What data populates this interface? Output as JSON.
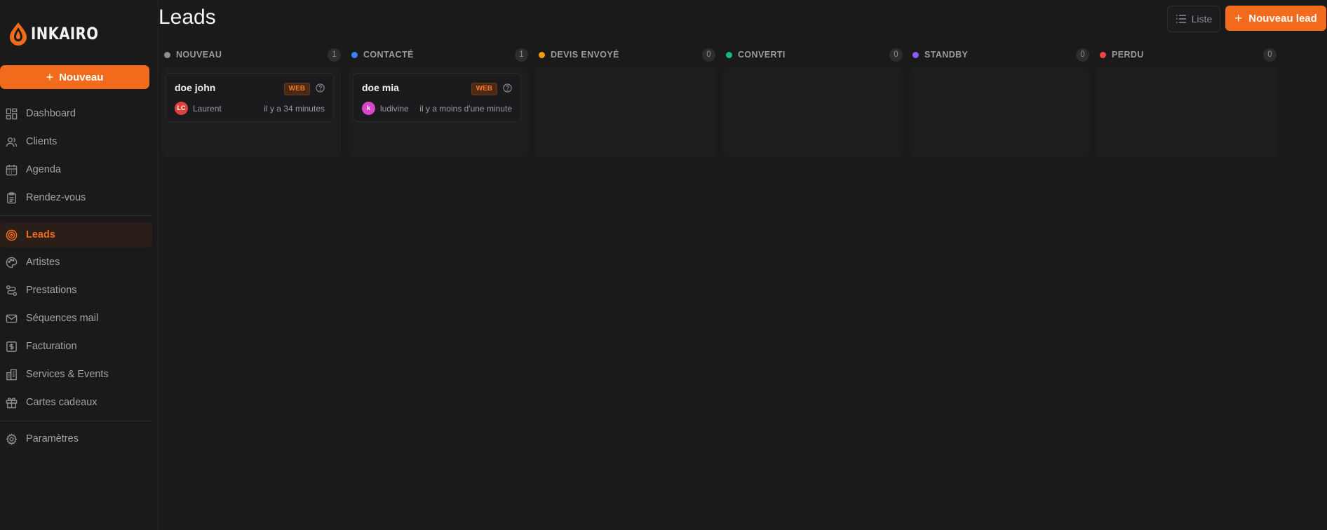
{
  "app": {
    "logo_text": "INKAIRO"
  },
  "sidebar": {
    "new_label": "Nouveau",
    "items": [
      {
        "label": "Dashboard",
        "icon": "dashboard-icon"
      },
      {
        "label": "Clients",
        "icon": "users-icon"
      },
      {
        "label": "Agenda",
        "icon": "calendar-icon"
      },
      {
        "label": "Rendez-vous",
        "icon": "clipboard-icon"
      },
      {
        "label": "Leads",
        "icon": "target-icon",
        "active": true
      },
      {
        "label": "Artistes",
        "icon": "palette-icon"
      },
      {
        "label": "Prestations",
        "icon": "route-icon"
      },
      {
        "label": "Séquences mail",
        "icon": "mail-icon"
      },
      {
        "label": "Facturation",
        "icon": "invoice-icon"
      },
      {
        "label": "Services & Events",
        "icon": "building-icon"
      },
      {
        "label": "Cartes cadeaux",
        "icon": "gift-icon"
      },
      {
        "label": "Paramètres",
        "icon": "gear-icon"
      }
    ]
  },
  "header": {
    "title": "Leads",
    "list_label": "Liste",
    "new_lead_label": "Nouveau lead"
  },
  "colors": {
    "accent": "#f26b1d",
    "nouveau": "#8e8e93",
    "contacte": "#3b82f6",
    "devis": "#f59e0b",
    "converti": "#10b981",
    "standby": "#8b5cf6",
    "perdu": "#ef4444"
  },
  "columns": [
    {
      "name": "NOUVEAU",
      "count": "1"
    },
    {
      "name": "CONTACTÉ",
      "count": "1"
    },
    {
      "name": "DEVIS ENVOYÉ",
      "count": "0"
    },
    {
      "name": "CONVERTI",
      "count": "0"
    },
    {
      "name": "STANDBY",
      "count": "0"
    },
    {
      "name": "PERDU",
      "count": "0"
    }
  ],
  "cards": [
    {
      "title": "doe john",
      "source": "WEB",
      "avatar": "LC",
      "owner": "Laurent",
      "time": "il y a 34 minutes"
    },
    {
      "title": "doe mia",
      "source": "WEB",
      "avatar": "k",
      "owner": "ludivine",
      "time": "il y a moins d'une minute"
    }
  ]
}
